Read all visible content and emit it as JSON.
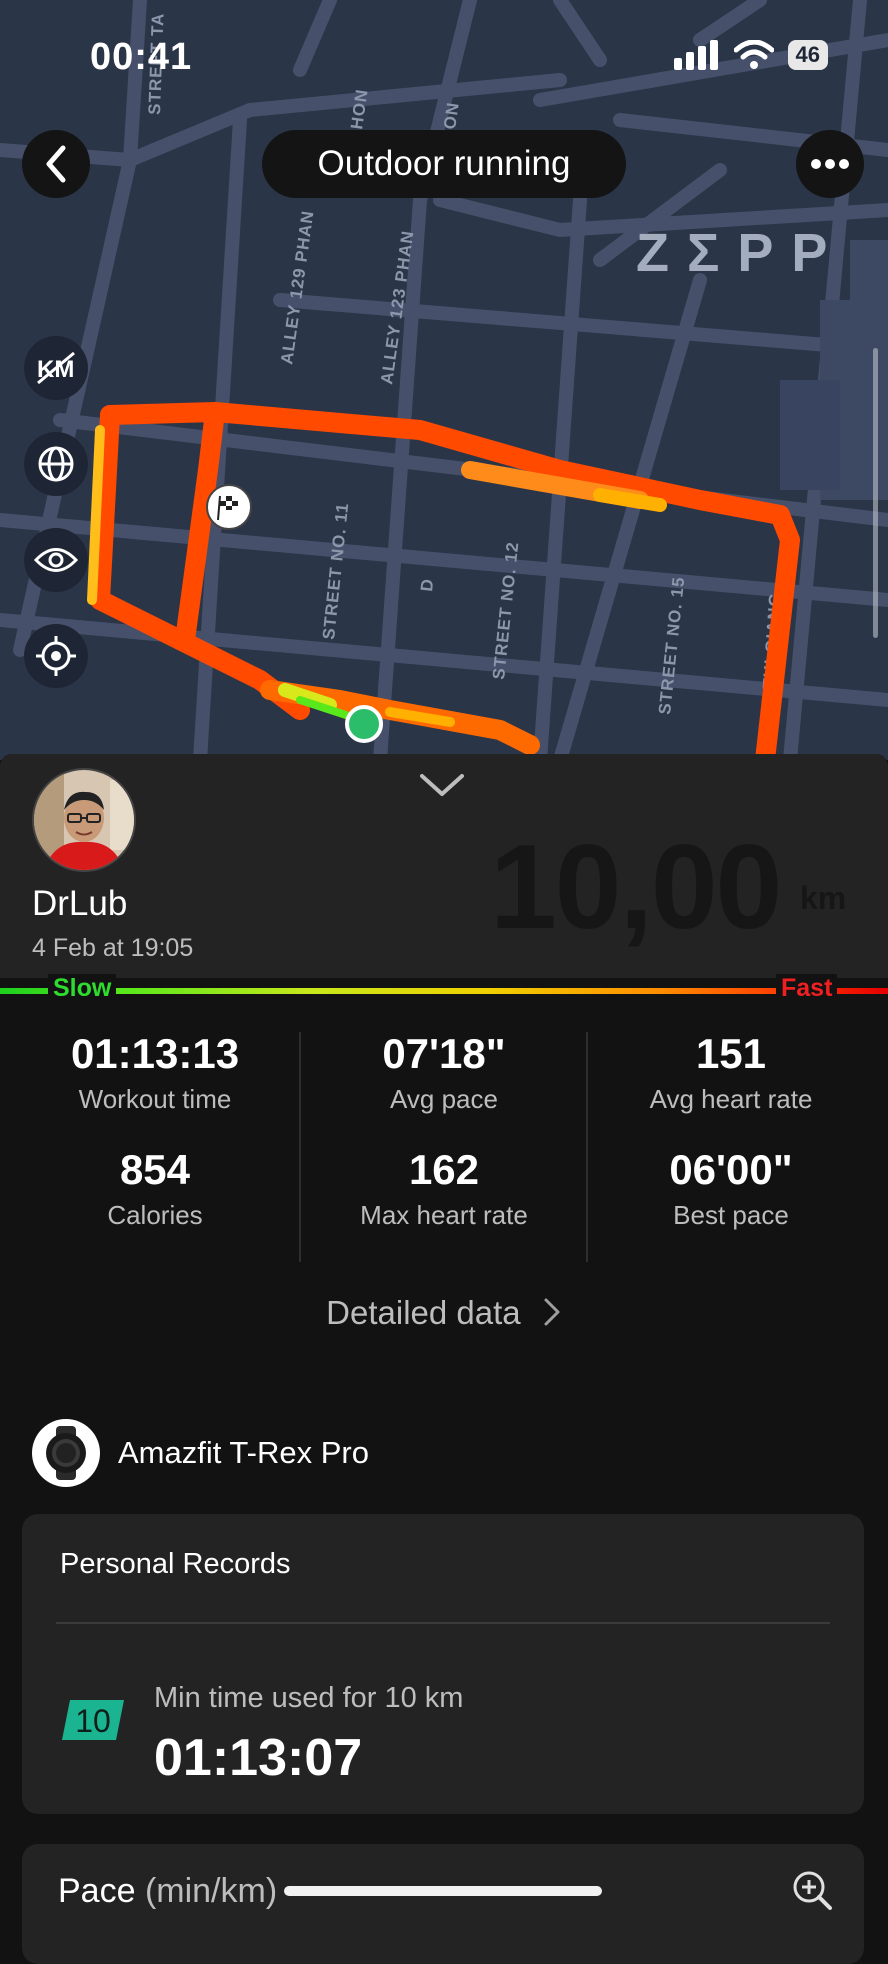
{
  "status_bar": {
    "time": "00:41",
    "battery": "46"
  },
  "header": {
    "title": "Outdoor running",
    "brand": "ZΣPP",
    "back_icon": "chevron-left-icon",
    "more_icon": "more-horizontal-icon"
  },
  "map": {
    "street_labels": [
      "STREET TA",
      "ALLEY 129 PHAN",
      "ALLEY 123 PHAN",
      "HON",
      "ON",
      "STREET NO. 11",
      "D",
      "STREET NO. 12",
      "STREET NO. 15",
      "UONG THI GIANG"
    ],
    "tools": [
      {
        "name": "km-marker-toggle",
        "icon": "km-icon"
      },
      {
        "name": "map-layer",
        "icon": "globe-icon"
      },
      {
        "name": "visibility",
        "icon": "eye-icon"
      },
      {
        "name": "recenter",
        "icon": "locate-icon"
      }
    ],
    "route_colors": {
      "slow": "#1fd01f",
      "medium": "#f0d000",
      "fast": "#ff3c00"
    }
  },
  "profile": {
    "username": "DrLub",
    "date": "4 Feb at 19:05",
    "distance": "10,00",
    "distance_unit": "km"
  },
  "pace_scale": {
    "slow_label": "Slow",
    "fast_label": "Fast"
  },
  "stats": [
    {
      "value": "01:13:13",
      "label": "Workout time"
    },
    {
      "value": "07'18\"",
      "label": "Avg pace"
    },
    {
      "value": "151",
      "label": "Avg heart rate"
    },
    {
      "value": "854",
      "label": "Calories"
    },
    {
      "value": "162",
      "label": "Max heart rate"
    },
    {
      "value": "06'00\"",
      "label": "Best pace"
    }
  ],
  "detailed_link": "Detailed data",
  "device": {
    "name": "Amazfit T-Rex Pro"
  },
  "records": {
    "title": "Personal Records",
    "badge": "10",
    "label": "Min time used for 10 km",
    "value": "01:13:07"
  },
  "pace_section": {
    "title": "Pace",
    "unit": "(min/km)"
  }
}
